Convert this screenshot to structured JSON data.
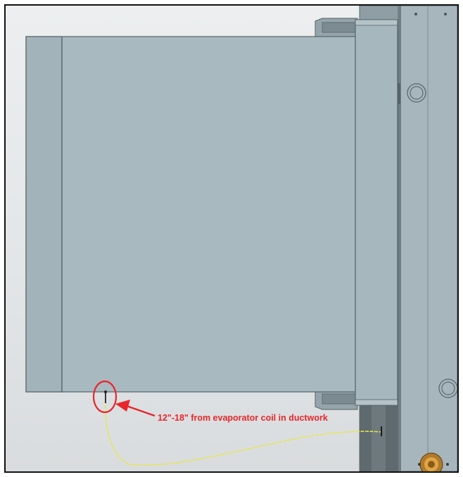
{
  "annotation": {
    "text": "12\"-18\" from evaporator coil in ductwork",
    "color": "#e8262b"
  },
  "components": {
    "duct": "supply-duct",
    "cabinet": "air-handler-cabinet",
    "sensor": "temperature-sensor-probe",
    "wire": "sensor-lead-wire",
    "fitting": "brass-drain-fitting"
  },
  "colors": {
    "panel": "#a8b8bf",
    "panel_dark": "#7d8d94",
    "wire": "#e6e64a",
    "callout": "#e8262b"
  }
}
